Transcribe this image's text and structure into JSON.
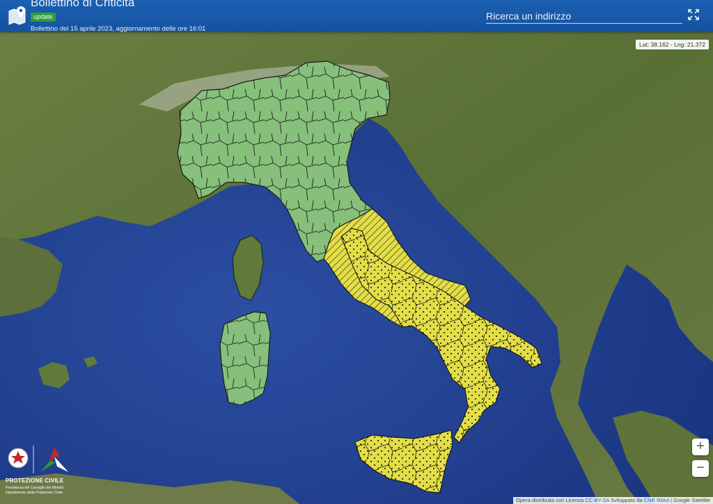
{
  "header": {
    "title": "Bollettino di Criticità",
    "badge": "update",
    "subtitle": "Bollettino del 15 aprile 2023, aggiornamento delle ore 16:01"
  },
  "search": {
    "placeholder": "Ricerca un indirizzo"
  },
  "map": {
    "coords_readout": "Lat: 38.162 - Lng: 21.372",
    "zoom_in": "+",
    "zoom_out": "−",
    "colors": {
      "sea": "#1e3d8c",
      "land": "#5e7a3a",
      "green_zone": "#86c07a",
      "yellow_zone": "#e6e04a",
      "border": "#1a1a1a"
    },
    "legend_levels": [
      "green",
      "yellow"
    ]
  },
  "logo": {
    "title": "PROTEZIONE CIVILE",
    "line1": "Presidenza del Consiglio dei Ministri",
    "line2": "Dipartimento della Protezione Civile"
  },
  "attribution": {
    "prefix": "Opera distribuita con Licenza",
    "license": "CC-BY-SA",
    "mid": "Sviluppato da",
    "developer": "CNR IMAA",
    "suffix": "| Google Satellite"
  }
}
